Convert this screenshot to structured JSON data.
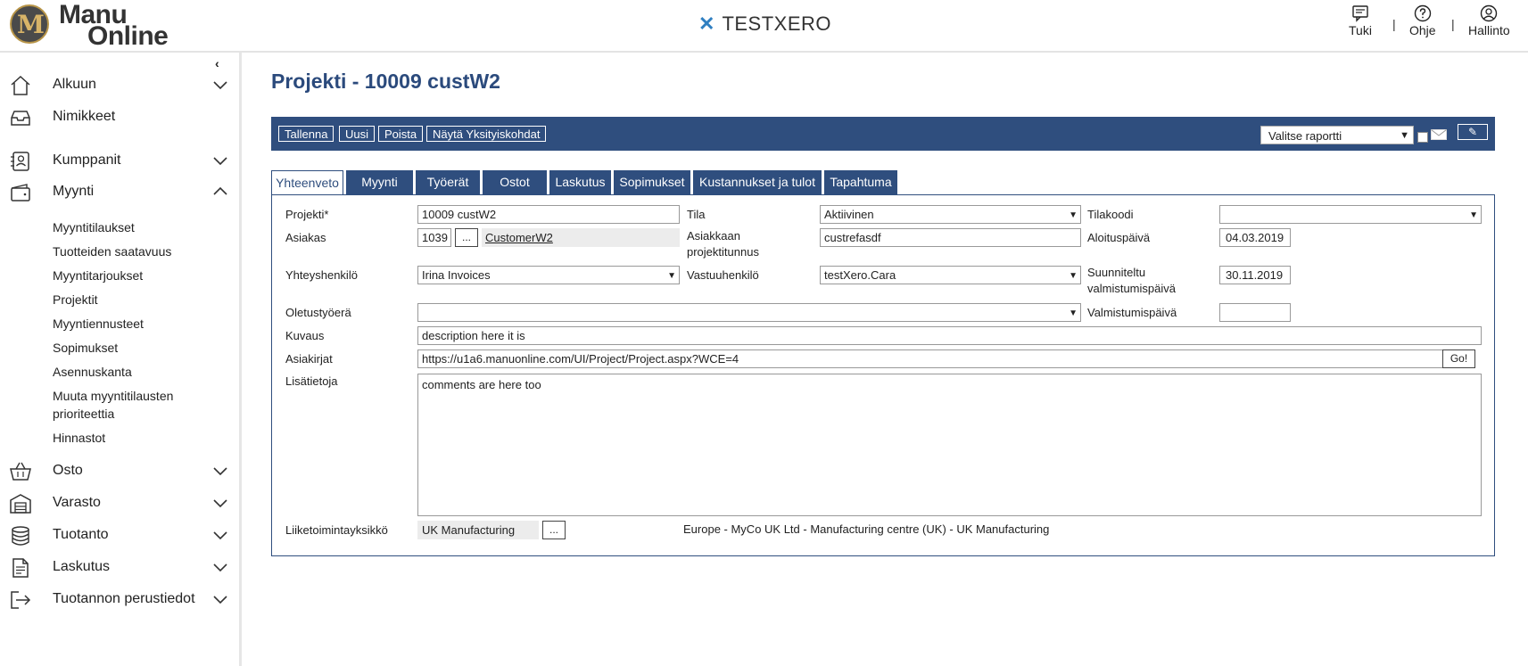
{
  "header": {
    "logo_line1": "Manu",
    "logo_line2": "Online",
    "logo_letter": "M",
    "company_icon": "xero-cross-icon",
    "company": "TESTXERO",
    "links": [
      {
        "label": "Tuki",
        "icon": "chat-icon"
      },
      {
        "label": "Ohje",
        "icon": "help-icon"
      },
      {
        "label": "Hallinto",
        "icon": "user-icon"
      }
    ],
    "separator": "|"
  },
  "sidebar": {
    "collapse_glyph": "‹",
    "items": [
      {
        "label": "Alkuun",
        "icon": "home-icon",
        "expanded": false
      },
      {
        "label": "Nimikkeet",
        "icon": "inbox-icon"
      },
      {
        "label": "Kumppanit",
        "icon": "contacts-icon",
        "expanded": false
      },
      {
        "label": "Myynti",
        "icon": "wallet-icon",
        "expanded": true
      },
      {
        "label": "Osto",
        "icon": "basket-icon",
        "expanded": false
      },
      {
        "label": "Varasto",
        "icon": "warehouse-icon",
        "expanded": false
      },
      {
        "label": "Tuotanto",
        "icon": "database-icon",
        "expanded": false
      },
      {
        "label": "Laskutus",
        "icon": "invoice-icon",
        "expanded": false
      },
      {
        "label": "Tuotannon perustiedot",
        "icon": "logout-icon",
        "expanded": false
      }
    ],
    "myynti_sub": [
      "Myyntitilaukset",
      "Tuotteiden saatavuus",
      "Myyntitarjoukset",
      "Projektit",
      "Myyntiennusteet",
      "Sopimukset",
      "Asennuskanta",
      "Muuta myyntitilausten prioriteettia",
      "Hinnastot"
    ]
  },
  "main": {
    "title": "Projekti - 10009 custW2",
    "toolbar": {
      "buttons": [
        "Tallenna",
        "Uusi",
        "Poista",
        "Näytä Yksityiskohdat"
      ],
      "report_placeholder": "Valitse raportti",
      "attach_glyph": "✎"
    },
    "tabs": [
      "Yhteenveto",
      "Myynti",
      "Työerät",
      "Ostot",
      "Laskutus",
      "Sopimukset",
      "Kustannukset ja tulot",
      "Tapahtuma"
    ],
    "active_tab": "Yhteenveto",
    "form": {
      "projekti_label": "Projekti*",
      "projekti_value": "10009 custW2",
      "tila_label": "Tila",
      "tila_value": "Aktiivinen",
      "tilakoodi_label": "Tilakoodi",
      "tilakoodi_value": "",
      "asiakas_label": "Asiakas",
      "asiakas_id": "1039",
      "asiakas_btn": "...",
      "asiakas_name": "CustomerW2",
      "asiakkaan_label": "Asiakkaan projektitunnus",
      "asiakkaan_value": "custrefasdf",
      "aloitus_label": "Aloituspäivä",
      "aloitus_value": "04.03.2019",
      "yhteys_label": "Yhteyshenkilö",
      "yhteys_value": "Irina Invoices",
      "vastuu_label": "Vastuuhenkilö",
      "vastuu_value": "testXero.Cara",
      "suunniteltu_label": "Suunniteltu valmistumispäivä",
      "suunniteltu_value": "30.11.2019",
      "oletus_label": "Oletustyöerä",
      "oletus_value": "",
      "valmistumis_label": "Valmistumispäivä",
      "valmistumis_value": "",
      "kuvaus_label": "Kuvaus",
      "kuvaus_value": "description here it is",
      "asiakirjat_label": "Asiakirjat",
      "asiakirjat_value": "https://u1a6.manuonline.com/UI/Project/Project.aspx?WCE=4",
      "go_label": "Go!",
      "lisatiedot_label": "Lisätietoja",
      "lisatiedot_value": "comments are here too",
      "liiketoiminta_label": "Liiketoimintayksikkö",
      "liiketoiminta_value": "UK Manufacturing",
      "liiketoiminta_btn": "...",
      "liiketoiminta_path": "Europe - MyCo UK Ltd - Manufacturing centre (UK) - UK Manufacturing"
    }
  }
}
